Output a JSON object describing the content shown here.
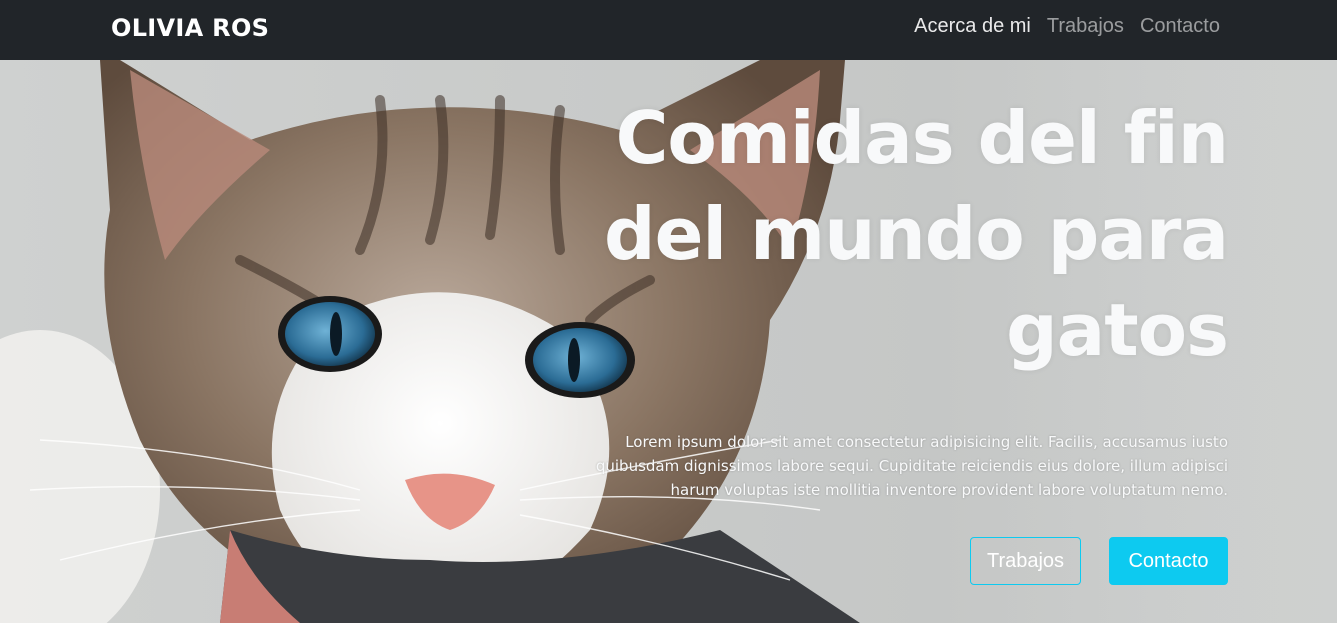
{
  "navbar": {
    "brand": "OLIVIA ROS",
    "links": [
      {
        "label": "Acerca de mi",
        "active": true
      },
      {
        "label": "Trabajos",
        "active": false
      },
      {
        "label": "Contacto",
        "active": false
      }
    ],
    "background": "#212529"
  },
  "hero": {
    "title_lines": [
      "Comidas del fin",
      "del mundo para",
      "gatos"
    ],
    "text_lines": [
      "Lorem ipsum dolor sit amet consectetur adipisicing elit. Facilis, accusamus iusto",
      "quibusdam dignissimos labore sequi. Cupiditate reiciendis eius dolore, illum adipisci",
      "harum voluptas iste mollitia inventore provident labore voluptatum nemo."
    ],
    "buttons": {
      "works": "Trabajos",
      "contact": "Contacto"
    },
    "accent": "#0dcaf0",
    "image": "kitten-photo"
  }
}
